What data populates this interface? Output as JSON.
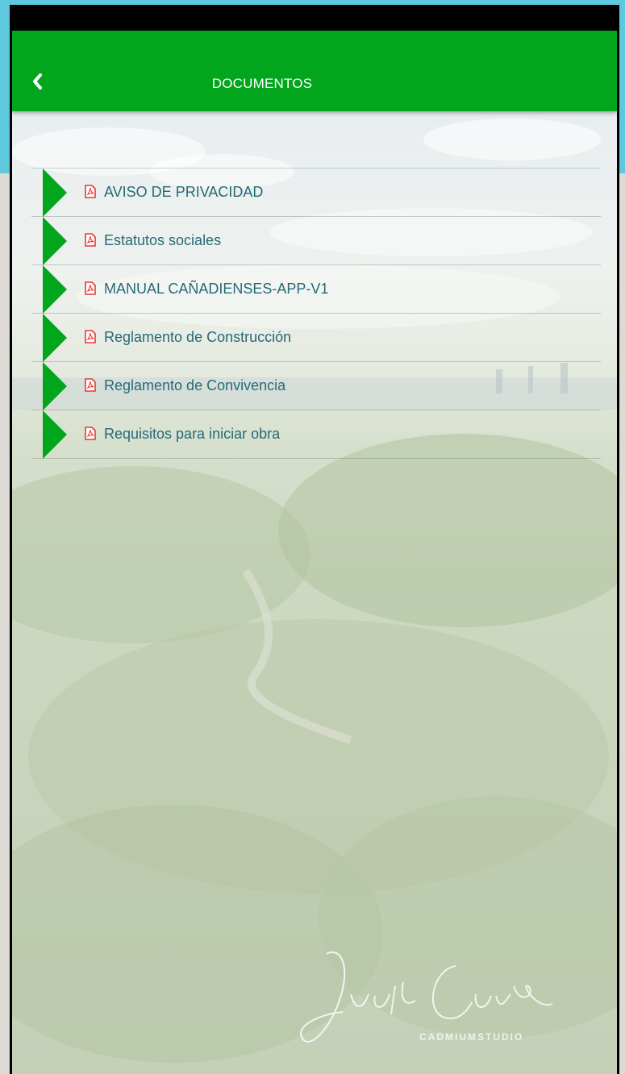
{
  "header": {
    "title": "DOCUMENTOS",
    "back_icon": "chevron-left-icon"
  },
  "documents": [
    {
      "label": "AVISO DE PRIVACIDAD",
      "icon": "pdf-icon"
    },
    {
      "label": "Estatutos sociales",
      "icon": "pdf-icon"
    },
    {
      "label": "MANUAL CAÑADIENSES-APP-V1",
      "icon": "pdf-icon"
    },
    {
      "label": "Reglamento de Construcción",
      "icon": "pdf-icon"
    },
    {
      "label": "Reglamento de Convivencia",
      "icon": "pdf-icon"
    },
    {
      "label": "Requisitos para iniciar obra",
      "icon": "pdf-icon"
    }
  ],
  "watermark": {
    "signature": "Justi Curiel",
    "studio": "CADMIUMSTUDIO"
  },
  "colors": {
    "appbar": "#02a61d",
    "flag": "#02a61d",
    "pdf_icon": "#e53935",
    "item_text": "#246b78",
    "outer_top": "#5ec8de"
  }
}
